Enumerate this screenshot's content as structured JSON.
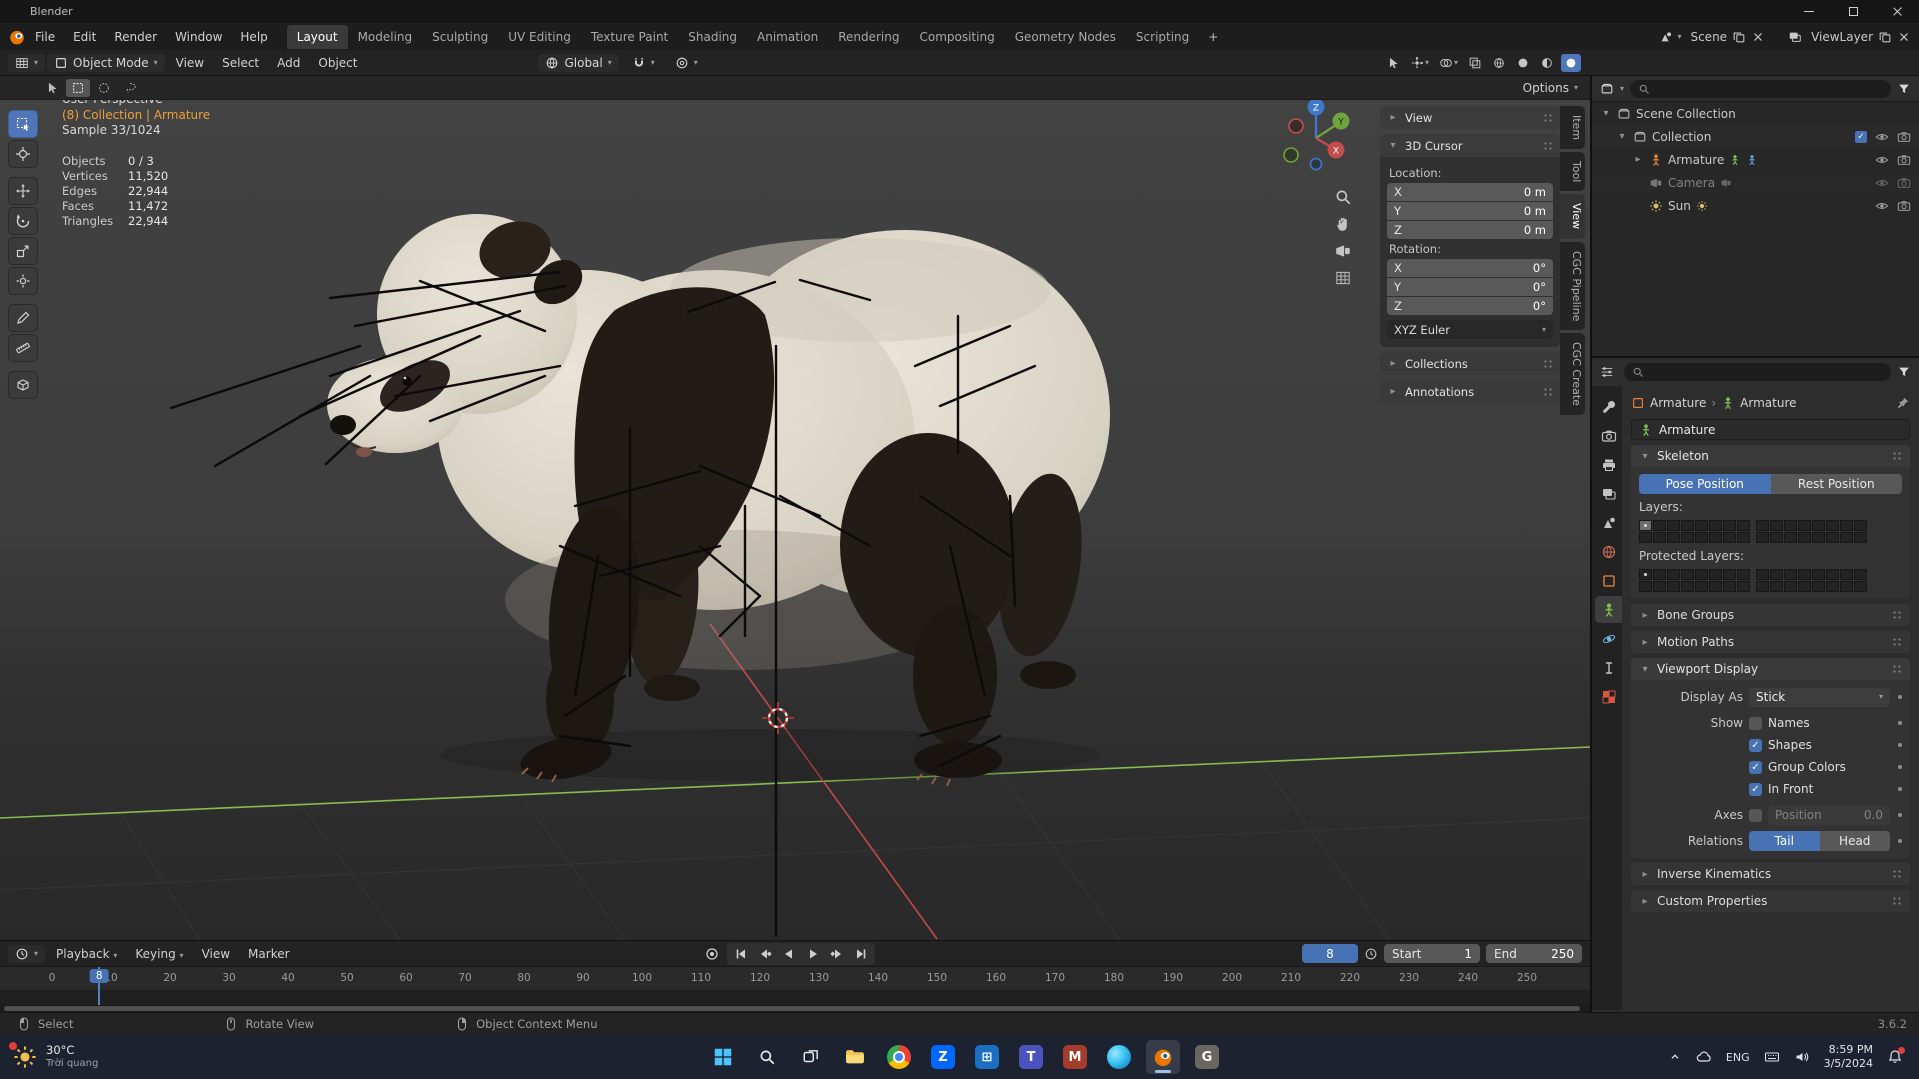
{
  "colors": {
    "accent": "#4772b3",
    "context_orange": "#eba23a",
    "axis_x": "#c24d4d",
    "axis_y": "#70a33f",
    "axis_z": "#3d78c9"
  },
  "window": {
    "title": "Blender"
  },
  "menubar": {
    "menus": [
      "File",
      "Edit",
      "Render",
      "Window",
      "Help"
    ],
    "workspaces": [
      "Layout",
      "Modeling",
      "Sculpting",
      "UV Editing",
      "Texture Paint",
      "Shading",
      "Animation",
      "Rendering",
      "Compositing",
      "Geometry Nodes",
      "Scripting"
    ],
    "active_workspace": "Layout",
    "add_tab": "+",
    "scene_label": "Scene",
    "viewlayer_label": "ViewLayer"
  },
  "header": {
    "mode": "Object Mode",
    "menus": [
      "View",
      "Select",
      "Add",
      "Object"
    ],
    "orientation": "Global",
    "tool_options": "Options"
  },
  "viewport": {
    "overlay": {
      "perspective": "User Perspective",
      "context": "(8) Collection | Armature",
      "sample": "Sample 33/1024",
      "stats": [
        {
          "label": "Objects",
          "value": "0 / 3"
        },
        {
          "label": "Vertices",
          "value": "11,520"
        },
        {
          "label": "Edges",
          "value": "22,944"
        },
        {
          "label": "Faces",
          "value": "11,472"
        },
        {
          "label": "Triangles",
          "value": "22,944"
        }
      ]
    },
    "tools": [
      "select-box",
      "cursor",
      "move",
      "rotate",
      "scale",
      "transform",
      "annotate",
      "measure",
      "add-cube"
    ],
    "active_tool": "select-box",
    "nav_icons": [
      "zoom",
      "pan",
      "camera",
      "grid"
    ],
    "gizmo_axes": [
      "X",
      "Y",
      "Z"
    ]
  },
  "n_panel": {
    "tabs": [
      "Item",
      "Tool",
      "View",
      "CGC Pipeline",
      "CGC Create"
    ],
    "active_tab": "View",
    "view_section": "View",
    "cursor_section": "3D Cursor",
    "location_label": "Location:",
    "location": [
      {
        "axis": "X",
        "value": "0 m"
      },
      {
        "axis": "Y",
        "value": "0 m"
      },
      {
        "axis": "Z",
        "value": "0 m"
      }
    ],
    "rotation_label": "Rotation:",
    "rotation": [
      {
        "axis": "X",
        "value": "0°"
      },
      {
        "axis": "Y",
        "value": "0°"
      },
      {
        "axis": "Z",
        "value": "0°"
      }
    ],
    "rotation_mode": "XYZ Euler",
    "collections_section": "Collections",
    "annotations_section": "Annotations"
  },
  "outliner": {
    "rows": [
      {
        "label": "Scene Collection",
        "icon": "scene-collection",
        "depth": 0,
        "expanded": true,
        "checkbox": false,
        "dimmed": false,
        "extra_icons": [],
        "right_icons": []
      },
      {
        "label": "Collection",
        "icon": "collection",
        "depth": 1,
        "expanded": true,
        "checkbox": true,
        "dimmed": false,
        "extra_icons": [],
        "right_icons": [
          "eye",
          "camera"
        ]
      },
      {
        "label": "Armature",
        "icon": "armature",
        "depth": 2,
        "expanded": false,
        "checkbox": false,
        "dimmed": false,
        "extra_icons": [
          "armature-data",
          "pose"
        ],
        "right_icons": [
          "eye",
          "camera"
        ]
      },
      {
        "label": "Camera",
        "icon": "camera-object",
        "depth": 2,
        "checkbox": false,
        "dimmed": true,
        "extra_icons": [
          "camera-data"
        ],
        "right_icons": [
          "eye",
          "camera"
        ]
      },
      {
        "label": "Sun",
        "icon": "light",
        "depth": 2,
        "checkbox": false,
        "dimmed": false,
        "extra_icons": [
          "light-data"
        ],
        "right_icons": [
          "eye",
          "camera"
        ]
      }
    ]
  },
  "properties": {
    "tabs": [
      "tool",
      "render",
      "output",
      "view-layer",
      "scene",
      "world",
      "object",
      "object-data",
      "physics",
      "constraints",
      "texture"
    ],
    "active_tab": "object-data",
    "breadcrumb": {
      "object": "Armature",
      "data": "Armature"
    },
    "name_value": "Armature",
    "skeleton": {
      "title": "Skeleton",
      "pose_button": "Pose Position",
      "rest_button": "Rest Position",
      "active_position": "Pose Position",
      "layers_label": "Layers:",
      "protected_layers_label": "Protected Layers:"
    },
    "collapsed_sections_top": [
      "Bone Groups",
      "Motion Paths"
    ],
    "viewport_display": {
      "title": "Viewport Display",
      "display_as_label": "Display As",
      "display_as_value": "Stick",
      "show_label": "Show",
      "options": [
        {
          "label": "Names",
          "checked": false
        },
        {
          "label": "Shapes",
          "checked": true
        },
        {
          "label": "Group Colors",
          "checked": true
        },
        {
          "label": "In Front",
          "checked": true
        }
      ],
      "axes_label": "Axes",
      "axes_checked": false,
      "position_label": "Position",
      "position_value": "0.0",
      "relations_label": "Relations",
      "tail_button": "Tail",
      "head_button": "Head",
      "active_relation": "Tail"
    },
    "collapsed_sections_bottom": [
      "Inverse Kinematics",
      "Custom Properties"
    ]
  },
  "timeline": {
    "menus": [
      {
        "label": "Playback",
        "dropdown": true
      },
      {
        "label": "Keying",
        "dropdown": true
      },
      {
        "label": "View",
        "dropdown": false
      },
      {
        "label": "Marker",
        "dropdown": false
      }
    ],
    "transport": [
      "jump-start",
      "prev-keyframe",
      "play-reverse",
      "play",
      "next-keyframe",
      "jump-end"
    ],
    "current_frame": "8",
    "frame_start_label": "Start",
    "frame_start": "1",
    "frame_end_label": "End",
    "frame_end": "250",
    "ruler_start": 0,
    "ruler_end": 250,
    "ruler_step": 10,
    "playhead_frame": 8
  },
  "statusbar": {
    "hints": [
      {
        "icon": "mouse-left",
        "label": "Select"
      },
      {
        "icon": "mouse-middle",
        "label": "Rotate View"
      },
      {
        "icon": "mouse-right",
        "label": "Object Context Menu"
      }
    ],
    "version": "3.6.2"
  },
  "taskbar": {
    "weather": {
      "temp": "30°C",
      "desc": "Trời quang"
    },
    "apps": [
      "start",
      "search",
      "task-view",
      "file-explorer",
      "chrome",
      "zalo",
      "store",
      "teams",
      "office",
      "edge",
      "blender",
      "gimp"
    ],
    "active_app": "blender",
    "tray": {
      "language": "ENG",
      "time": "8:59 PM",
      "date": "3/5/2024"
    }
  }
}
